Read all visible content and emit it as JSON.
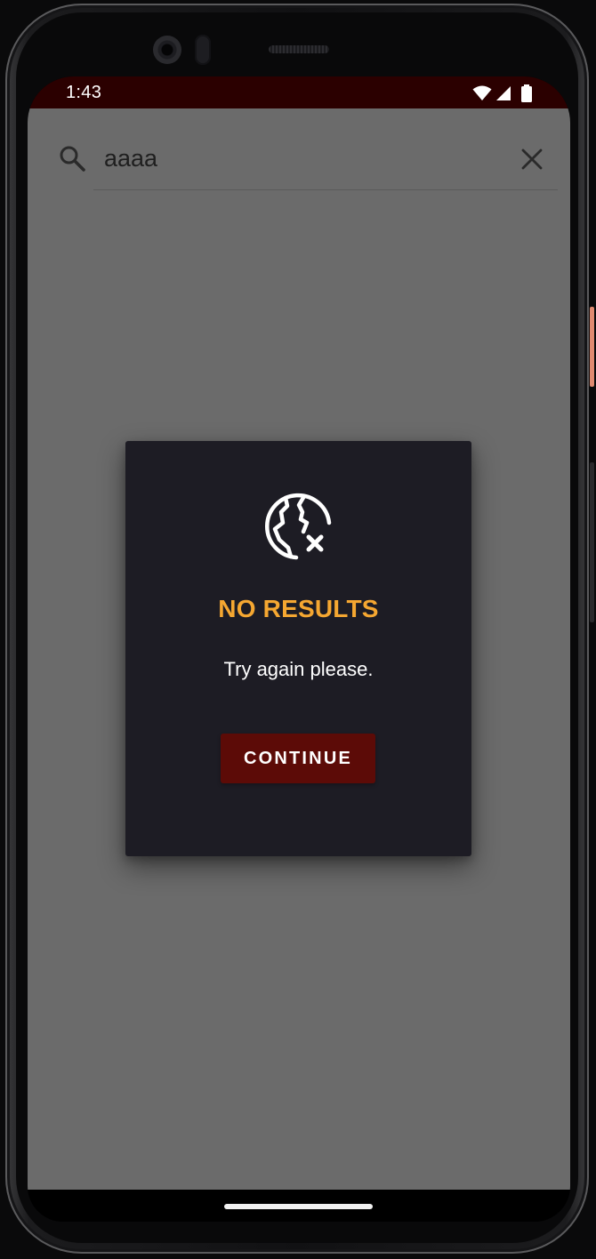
{
  "status_bar": {
    "time": "1:43"
  },
  "search": {
    "value": "aaaa",
    "search_icon": "search-icon",
    "clear_icon": "close-icon"
  },
  "dialog": {
    "icon": "globe-with-x-icon",
    "title": "NO RESULTS",
    "message": "Try again please.",
    "button_label": "CONTINUE"
  },
  "colors": {
    "status_bar_bg": "#2b0000",
    "scrim": "#6b6b6b",
    "dialog_bg": "#1d1c24",
    "title_accent": "#f5a731",
    "button_bg": "#5c0b07"
  }
}
